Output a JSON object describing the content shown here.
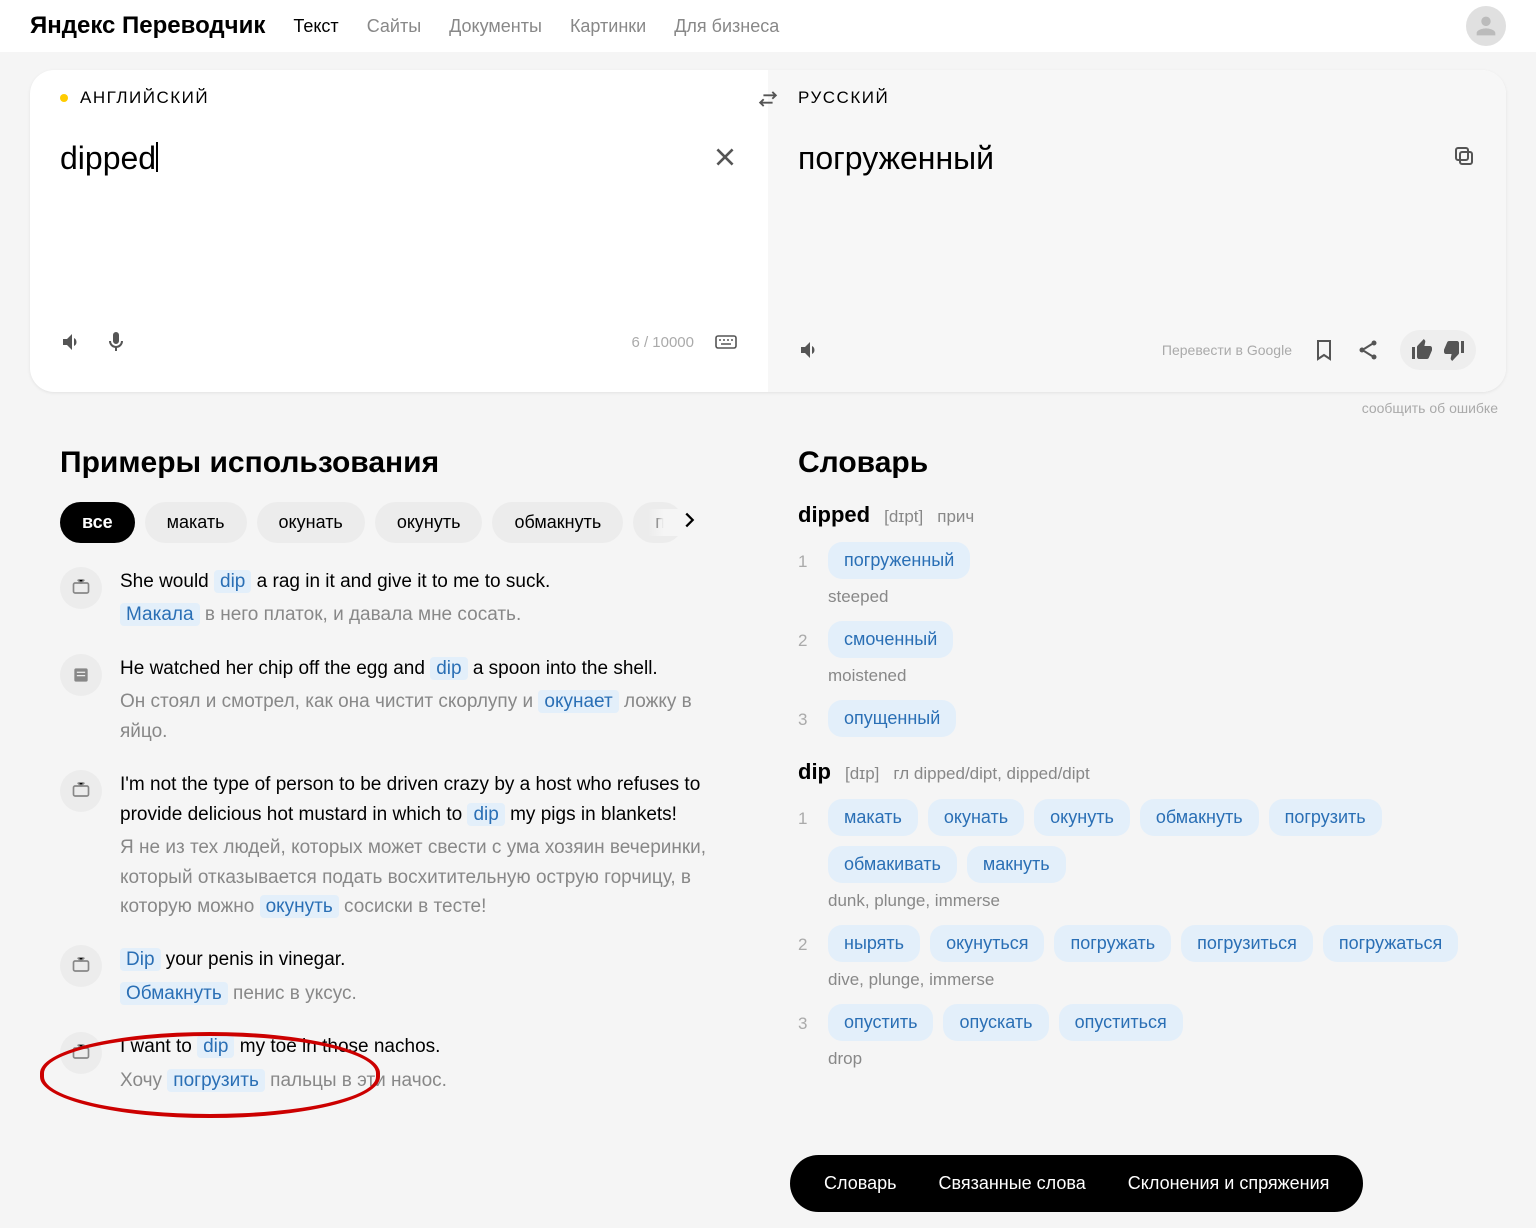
{
  "header": {
    "logo": "Яндекс Переводчик",
    "nav": [
      "Текст",
      "Сайты",
      "Документы",
      "Картинки",
      "Для бизнеса"
    ],
    "active_nav": 0
  },
  "translation": {
    "src_lang": "АНГЛИЙСКИЙ",
    "tgt_lang": "РУССКИЙ",
    "src_text": "dipped",
    "tgt_text": "погруженный",
    "char_count": "6 / 10000",
    "ext_link": "Перевести в Google"
  },
  "report_error": "сообщить об ошибке",
  "examples": {
    "title": "Примеры использования",
    "chips": [
      "все",
      "макать",
      "окунать",
      "окунуть",
      "обмакнуть",
      "погрузить"
    ],
    "items": [
      {
        "en_pre": "She would ",
        "en_hl": "dip",
        "en_post": " a rag in it and give it to me to suck.",
        "ru_hl": "Макала",
        "ru_post": " в него платок, и давала мне сосать.",
        "icon": "tv"
      },
      {
        "en_pre": "He watched her chip off the egg and ",
        "en_hl": "dip",
        "en_post": " a spoon into the shell.",
        "ru_pre": "Он стоял и смотрел, как она чистит скорлупу и ",
        "ru_hl": "окунает",
        "ru_post": " ложку в яйцо.",
        "icon": "book"
      },
      {
        "en_pre": "I'm not the type of person to be driven crazy by a host who refuses to provide delicious hot mustard in which to ",
        "en_hl": "dip",
        "en_post": " my pigs in blankets!",
        "ru_pre": "Я не из тех людей, которых может свести с ума хозяин вечеринки, который отказывается подать восхитительную острую горчицу, в которую можно ",
        "ru_hl": "окунуть",
        "ru_post": " сосиски в тесте!",
        "icon": "tv"
      },
      {
        "en_hl": "Dip",
        "en_post": " your penis in vinegar.",
        "ru_hl": "Обмакнуть",
        "ru_post": " пенис в уксус.",
        "icon": "tv"
      },
      {
        "en_pre": "I want to ",
        "en_hl": "dip",
        "en_post": " my toe in those nachos.",
        "ru_pre": "Хочу ",
        "ru_hl": "погрузить",
        "ru_post": " пальцы в эти начос.",
        "icon": "tv"
      }
    ]
  },
  "dictionary": {
    "title": "Словарь",
    "entries": [
      {
        "head": "dipped",
        "ipa": "[dɪpt]",
        "pos": "прич",
        "senses": [
          {
            "tags": [
              "погруженный"
            ],
            "gloss": "steeped"
          },
          {
            "tags": [
              "смоченный"
            ],
            "gloss": "moistened"
          },
          {
            "tags": [
              "опущенный"
            ],
            "gloss": ""
          }
        ]
      },
      {
        "head": "dip",
        "ipa": "[dɪp]",
        "pos": "гл dipped/dipt, dipped/dipt",
        "senses": [
          {
            "tags": [
              "макать",
              "окунать",
              "окунуть",
              "обмакнуть",
              "погрузить",
              "обмакивать",
              "макнуть"
            ],
            "gloss": "dunk, plunge, immerse"
          },
          {
            "tags": [
              "нырять",
              "окунуться",
              "погружать",
              "погрузиться",
              "погружаться"
            ],
            "gloss": "dive, plunge, immerse"
          },
          {
            "tags": [
              "опустить",
              "опускать",
              "опуститься"
            ],
            "gloss": "drop"
          }
        ]
      }
    ]
  },
  "bottom_nav": [
    "Словарь",
    "Связанные слова",
    "Склонения и спряжения"
  ]
}
